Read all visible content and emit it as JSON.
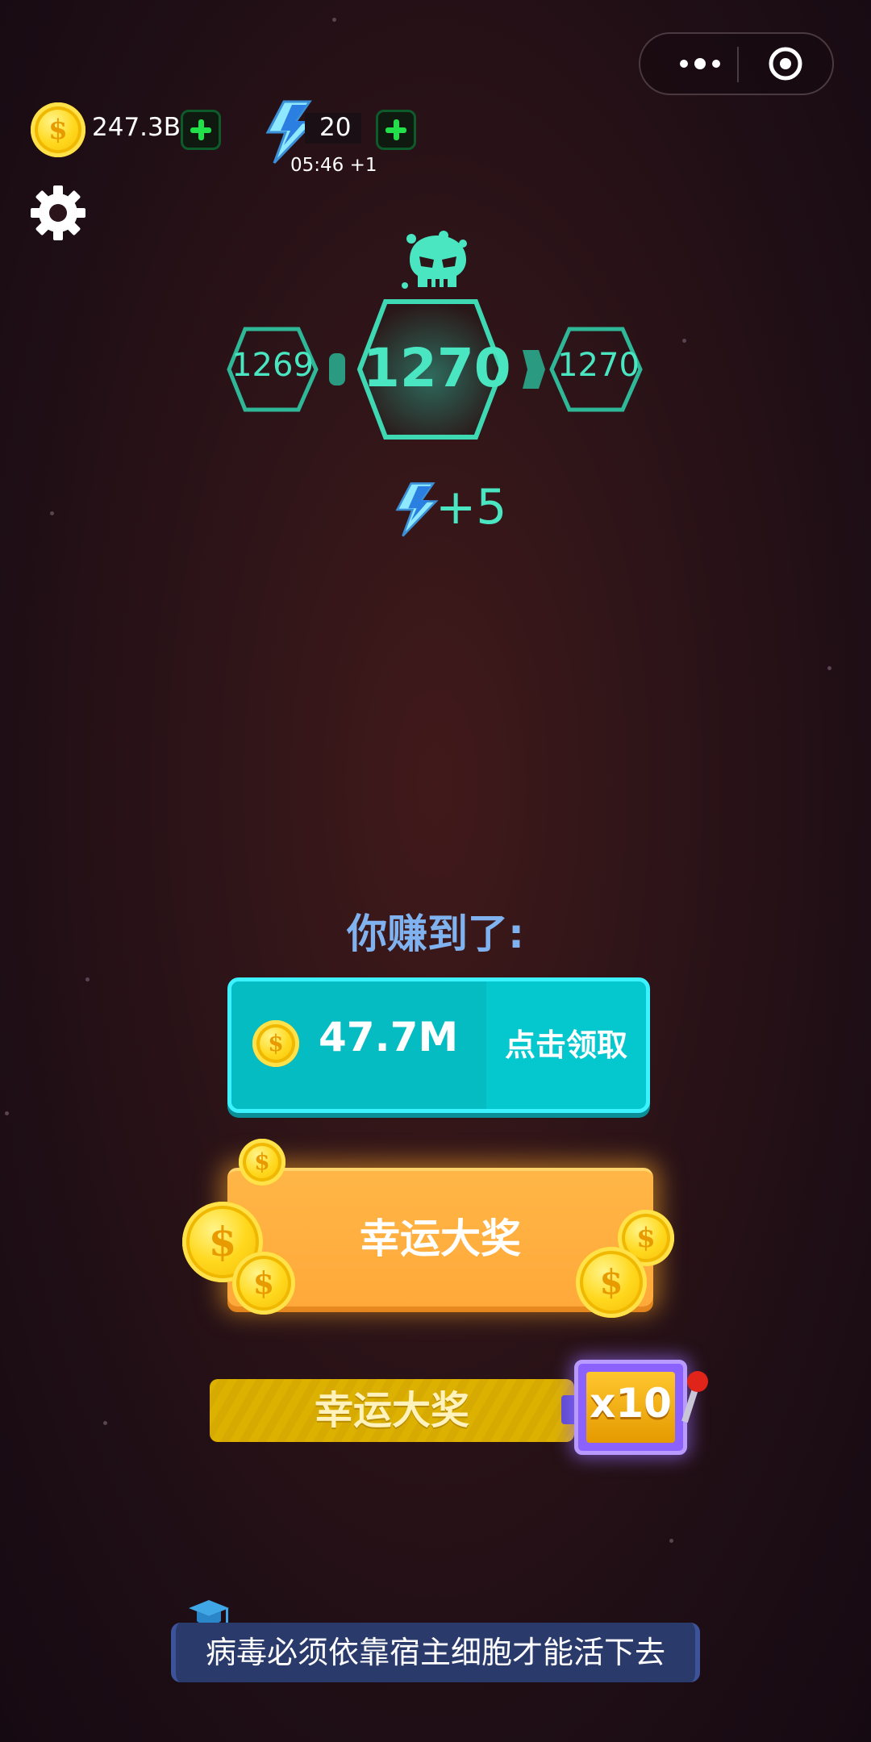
{
  "top_bar": {
    "coins": "247.3B",
    "energy": "20",
    "energy_timer": "05:46 +1"
  },
  "level": {
    "previous": "1269",
    "current": "1270",
    "next": "1270",
    "energy_reward": "+5"
  },
  "reward": {
    "earned_label": "你赚到了:",
    "amount": "47.7M",
    "claim_label": "点击领取",
    "coin_symbol": "$"
  },
  "jackpot": {
    "label": "幸运大奖"
  },
  "slot_jackpot": {
    "label": "幸运大奖",
    "multiplier": "x10"
  },
  "tip": {
    "text": "病毒必须依靠宿主细胞才能活下去"
  },
  "colors": {
    "level_accent": "#49e6c1",
    "claim_button": "#05c8cf",
    "jackpot_button": "#ffa93a",
    "slot_bar": "#dcb100",
    "tip_banner": "#2a3a6b"
  },
  "icons": {
    "coin": "coin-icon",
    "energy": "lightning-icon",
    "add": "plus-icon",
    "settings": "gear-icon",
    "boss": "skull-icon",
    "tip": "graduation-cap-icon",
    "menu": "more-dots-icon",
    "close": "target-icon"
  }
}
